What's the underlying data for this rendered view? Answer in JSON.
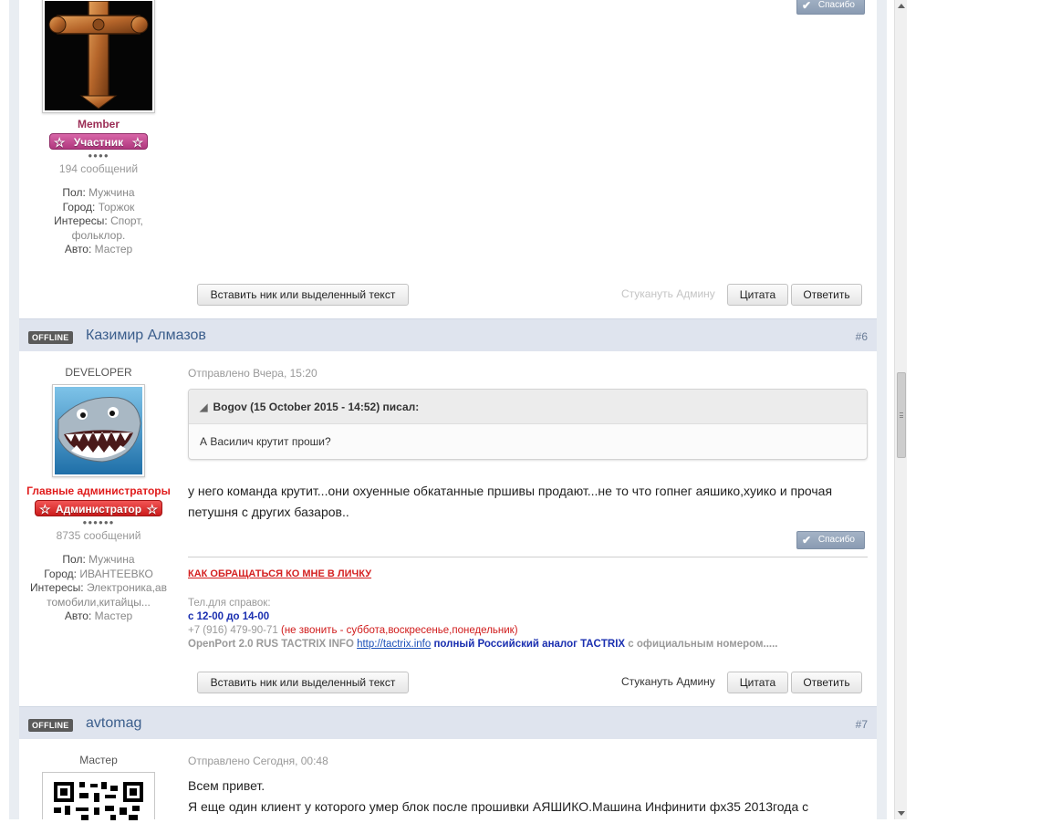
{
  "posts": [
    {
      "user": {
        "group": "Member",
        "rank": "Участник",
        "rank_pips": "●●●●",
        "post_count": "194 сообщений",
        "fields": [
          {
            "label": "Пол:",
            "value": "Мужчина"
          },
          {
            "label": "Город:",
            "value": "Торжок"
          },
          {
            "label": "Интересы:",
            "value": "Спорт,"
          },
          {
            "label": "",
            "value": "фольклор."
          },
          {
            "label": "Авто:",
            "value": "Мастер"
          }
        ]
      },
      "thanks_label": "Спасибо",
      "insert_nick_label": "Вставить ник или выделенный текст",
      "report_label": "Стукануть Админу",
      "quote_label": "Цитата",
      "reply_label": "Ответить"
    },
    {
      "status": "OFFLINE",
      "author": "Казимир Алмазов",
      "number": "#6",
      "user": {
        "title": "DEVELOPER",
        "group": "Главные администраторы",
        "rank": "Администратор",
        "rank_pips": "●●●●●●",
        "post_count": "8735 сообщений",
        "fields": [
          {
            "label": "Пол:",
            "value": "Мужчина"
          },
          {
            "label": "Город:",
            "value": "ИВАНТЕЕВКО"
          },
          {
            "label": "Интересы:",
            "value": "Электроника,ав"
          },
          {
            "label": "",
            "value": "томобили,китайцы..."
          },
          {
            "label": "Авто:",
            "value": "Мастер"
          }
        ]
      },
      "posted": "Отправлено Вчера, 15:20",
      "quote_author": "Bogov (15 October 2015 - 14:52) писал:",
      "quote_text": "А Василич крутит проши?",
      "text_line1": "у него команда крутит...они охуенные обкатанные пршивы продают...не то что гопнег аяшико,хуико и прочая",
      "text_line2": "петушня с других базаров..",
      "thanks_label": "Спасибо",
      "signature": {
        "link": "КАК ОБРАЩАТЬСЯ КО МНЕ В ЛИЧКУ",
        "phone_label": "Тел.для справок:",
        "hours": "с 12-00 до 14-00",
        "phone": "+7 (916) 479-90-71",
        "phone_note": "(не звонить - суббота,воскресенье,понедельник)",
        "product": "OpenPort 2.0 RUS TACTRIX INFO",
        "url": "http://tactrix.info",
        "analog": "полный Российский аналог TACTRIX",
        "official": "с официальным номером....."
      },
      "insert_nick_label": "Вставить ник или выделенный текст",
      "report_label": "Стукануть Админу",
      "quote_label": "Цитата",
      "reply_label": "Ответить"
    },
    {
      "status": "OFFLINE",
      "author": "avtomag",
      "number": "#7",
      "user": {
        "title": "Мастер"
      },
      "posted": "Отправлено Сегодня, 00:48",
      "text_line1": "Всем привет.",
      "text_line2": "Я еще один клиент у которого умер блок после прошивки АЯШИКО.Машина Инфинити фх35 2013года с"
    }
  ],
  "colors": {
    "header_bg": "#dfe4ee",
    "author_link": "#3b5e8c",
    "member_group": "#9b2d55",
    "member_rank": "#c2478f",
    "admin_group": "#e01b1b",
    "admin_rank": "#e03030"
  }
}
